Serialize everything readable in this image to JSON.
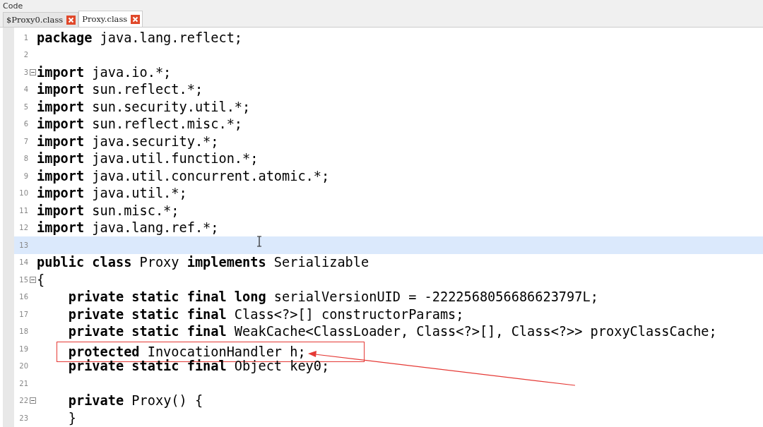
{
  "panel": {
    "title": "Code"
  },
  "tabs": [
    {
      "label": "$Proxy0.class",
      "selected": false
    },
    {
      "label": "Proxy.class",
      "selected": true
    }
  ],
  "lines": [
    {
      "number": "1",
      "code": "**package** java.lang.reflect;",
      "fold": false,
      "current": false,
      "boxed": false
    },
    {
      "number": "2",
      "fold": false,
      "current": false,
      "boxed": false
    },
    {
      "number": "3",
      "code": "**import** java.io.*;",
      "fold": true,
      "current": false,
      "boxed": false
    },
    {
      "number": "4",
      "code": "**import** sun.reflect.*;",
      "fold": false,
      "current": false,
      "boxed": false
    },
    {
      "number": "5",
      "code": "**import** sun.security.util.*;",
      "fold": false,
      "current": false,
      "boxed": false
    },
    {
      "number": "6",
      "code": "**import** sun.reflect.misc.*;",
      "fold": false,
      "current": false,
      "boxed": false
    },
    {
      "number": "7",
      "code": "**import** java.security.*;",
      "fold": false,
      "current": false,
      "boxed": false
    },
    {
      "number": "8",
      "code": "**import** java.util.function.*;",
      "fold": false,
      "current": false,
      "boxed": false
    },
    {
      "number": "9",
      "code": "**import** java.util.concurrent.atomic.*;",
      "fold": false,
      "current": false,
      "boxed": false
    },
    {
      "number": "10",
      "code": "**import** java.util.*;",
      "fold": false,
      "current": false,
      "boxed": false
    },
    {
      "number": "11",
      "code": "**import** sun.misc.*;",
      "fold": false,
      "current": false,
      "boxed": false
    },
    {
      "number": "12",
      "code": "**import** java.lang.ref.*;",
      "fold": false,
      "current": false,
      "boxed": false
    },
    {
      "number": "13",
      "fold": false,
      "current": true,
      "boxed": false
    },
    {
      "number": "14",
      "code": "**public class** Proxy **implements** Serializable",
      "fold": false,
      "current": false,
      "boxed": false
    },
    {
      "number": "15",
      "code": "{",
      "fold": true,
      "current": false,
      "boxed": false
    },
    {
      "number": "16",
      "code": "    **private static final long** serialVersionUID = -2222568056686623797L;",
      "fold": false,
      "current": false,
      "boxed": false
    },
    {
      "number": "17",
      "code": "    **private static final** Class<?>[] constructorParams;",
      "fold": false,
      "current": false,
      "boxed": false
    },
    {
      "number": "18",
      "code": "    **private static final** WeakCache<ClassLoader, Class<?>[], Class<?>> proxyClassCache;",
      "fold": false,
      "current": false,
      "boxed": false
    },
    {
      "number": "19",
      "code": "    **protected** InvocationHandler h;",
      "fold": false,
      "current": false,
      "boxed": true
    },
    {
      "number": "20",
      "code": "    **private static final** Object key0;",
      "fold": false,
      "current": false,
      "boxed": false
    },
    {
      "number": "21",
      "fold": false,
      "current": false,
      "boxed": false
    },
    {
      "number": "22",
      "code": "    **private** Proxy() {",
      "fold": true,
      "current": false,
      "boxed": false
    },
    {
      "number": "23",
      "code": "    }",
      "fold": false,
      "current": false,
      "boxed": false
    }
  ]
}
